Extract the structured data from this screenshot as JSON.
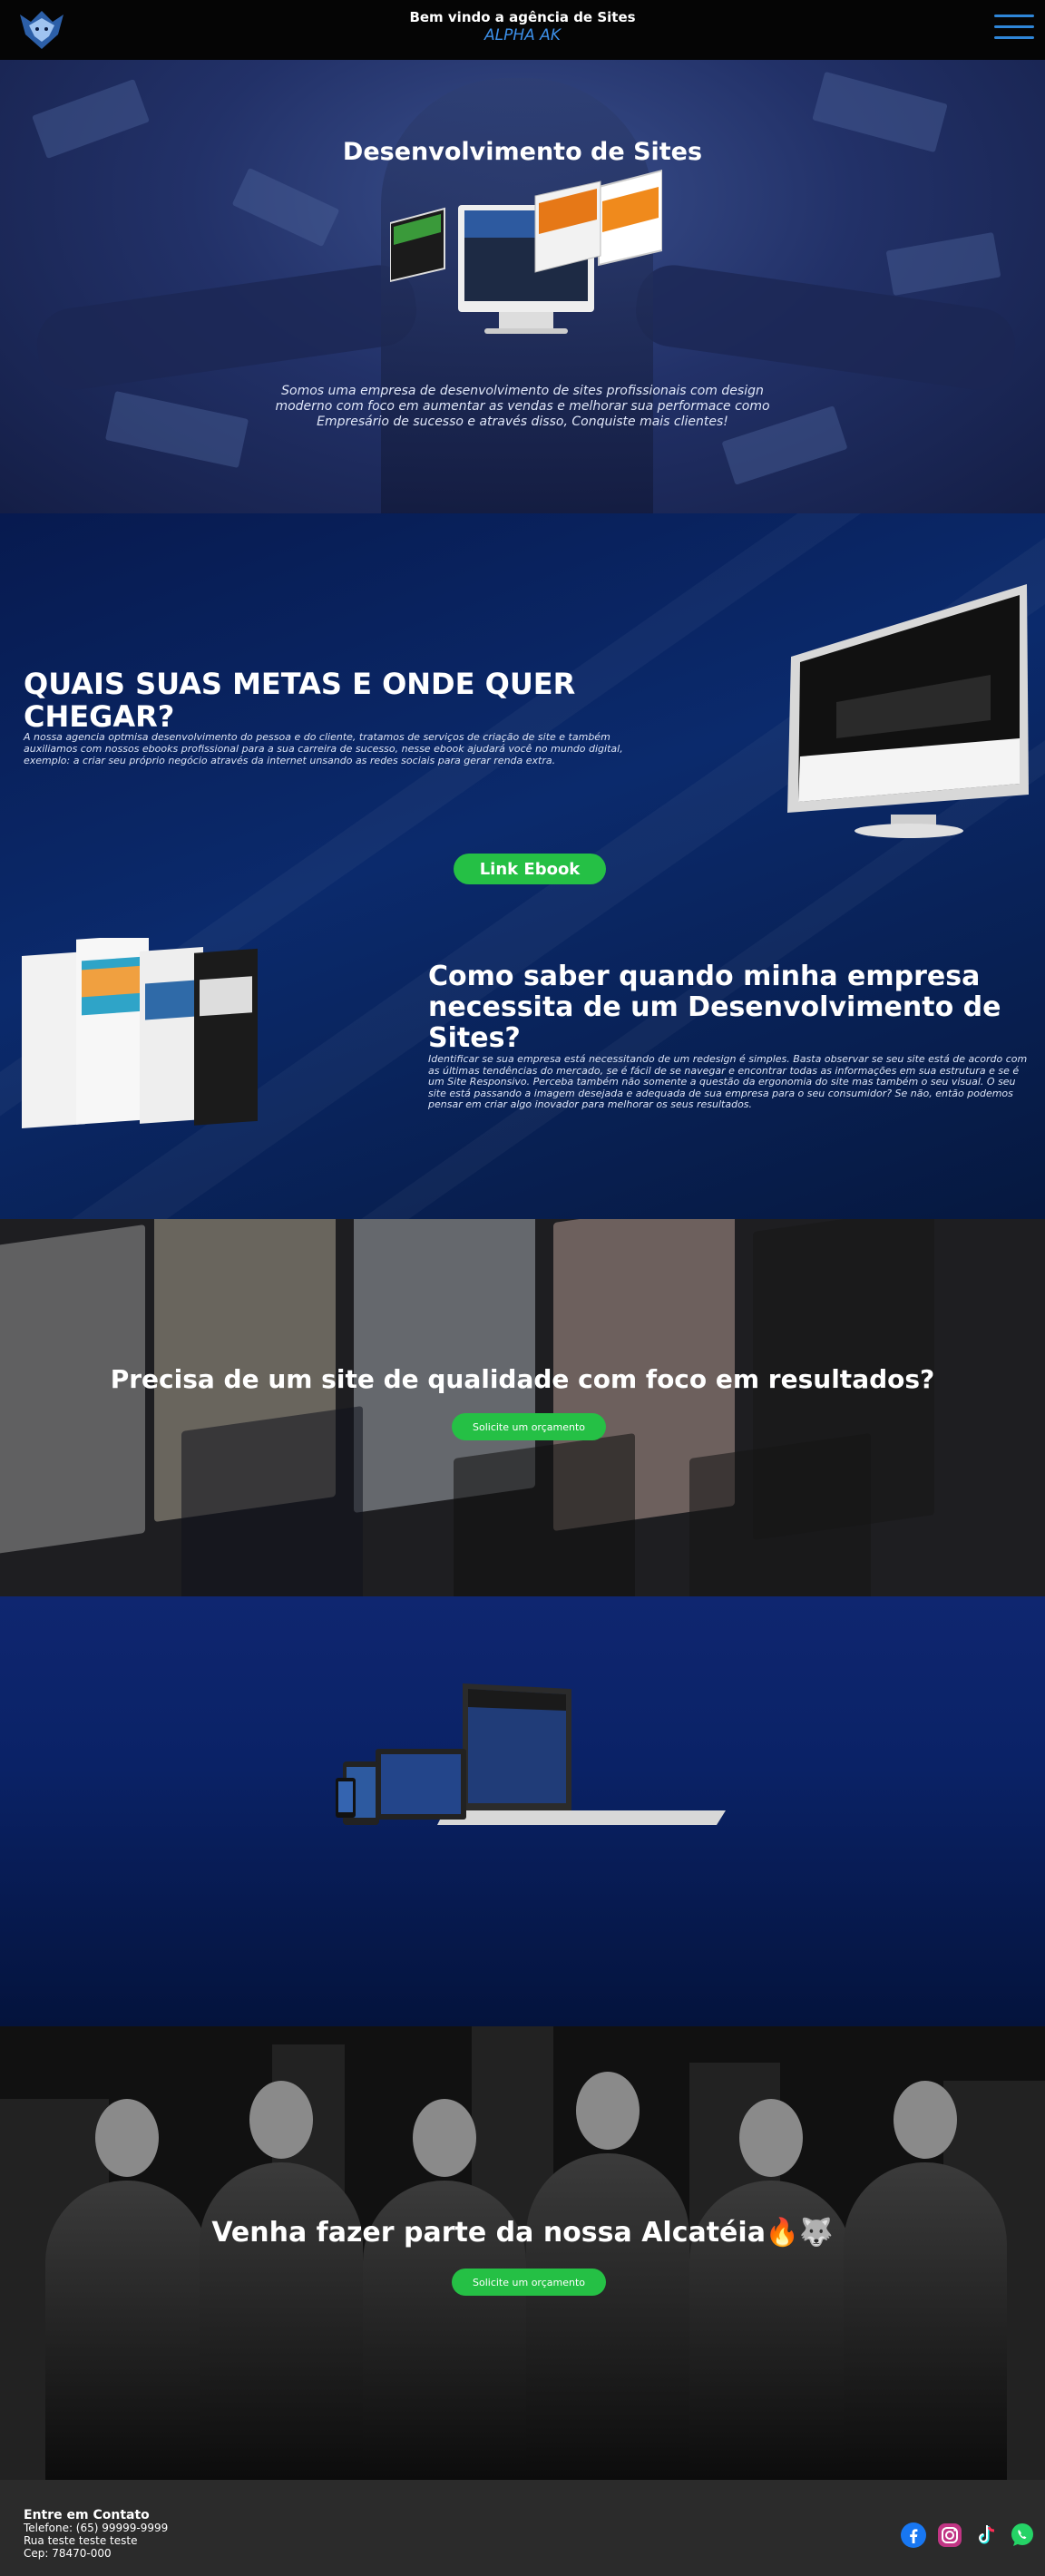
{
  "header": {
    "title": "Bem vindo a agência de Sites",
    "brand": "ALPHA AK"
  },
  "hero": {
    "title": "Desenvolvimento de Sites",
    "text": "Somos uma empresa de desenvolvimento de sites profissionais com design moderno com foco em aumentar as vendas e melhorar sua performace como Empresário de sucesso e através disso, Conquiste mais clientes!"
  },
  "goals": {
    "heading": "QUAIS SUAS METAS E ONDE QUER CHEGAR?",
    "text": "A nossa agencia optmisa desenvolvimento do pessoa e do cliente, tratamos de serviços de criação de site e também auxiliamos com nossos ebooks profissional para a sua carreira de sucesso, nesse ebook ajudará você no mundo digital, exemplo: a criar seu próprio negócio através da internet unsando as redes sociais para gerar renda extra.",
    "ebook_button": "Link Ebook"
  },
  "question": {
    "heading": "Como saber quando minha empresa necessita de um Desenvolvimento de Sites?",
    "text": "Identificar se sua empresa está necessitando de um redesign é simples. Basta  observar se seu site está de acordo com as últimas tendências do mercado, se é fácil de se navegar e encontrar todas as informações em sua estrutura e se é um Site Responsivo. Perceba também não somente a questão da ergonomia do site mas também o seu visual. O seu site está passando a imagem desejada e adequada de sua empresa para o seu consumidor? Se não, então podemos pensar em criar algo inovador para melhorar os seus resultados."
  },
  "quality": {
    "title": "Precisa de um site de qualidade com foco em resultados?",
    "button": "Solicite um orçamento"
  },
  "team": {
    "title": "Venha fazer parte da nossa Alcatéia🔥🐺",
    "button": "Solicite um orçamento"
  },
  "footer": {
    "title": "Entre em Contato",
    "phone": "Telefone: (65) 99999-9999",
    "address": "Rua teste teste teste",
    "cep": "Cep: 78470-000"
  },
  "colors": {
    "accent_blue": "#2f86d8",
    "button_green": "#25c045",
    "footer_bg": "#2b2b2b"
  },
  "icons": [
    "facebook-icon",
    "instagram-icon",
    "tiktok-icon",
    "whatsapp-icon"
  ]
}
